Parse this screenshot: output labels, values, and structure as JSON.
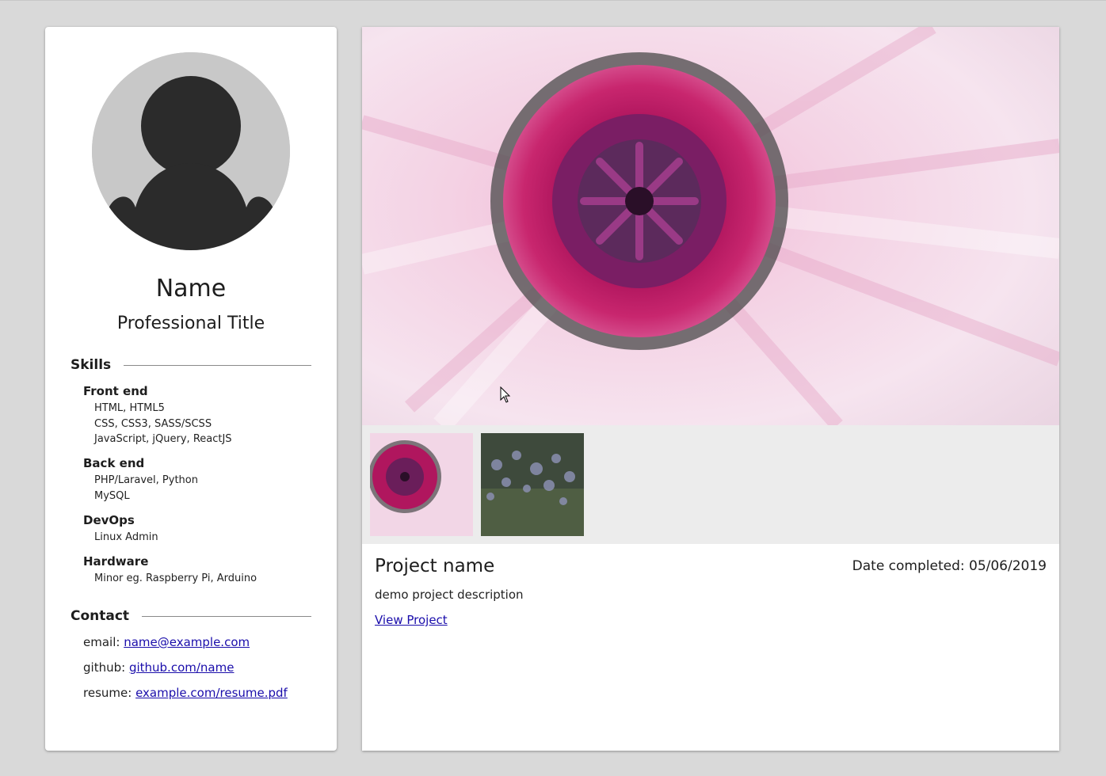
{
  "profile": {
    "name": "Name",
    "title": "Professional Title",
    "avatar_icon": "user-silhouette-icon"
  },
  "skills": {
    "heading": "Skills",
    "groups": [
      {
        "title": "Front end",
        "items": [
          "HTML, HTML5",
          "CSS, CSS3, SASS/SCSS",
          "JavaScript, jQuery, ReactJS"
        ]
      },
      {
        "title": "Back end",
        "items": [
          "PHP/Laravel, Python",
          "MySQL"
        ]
      },
      {
        "title": "DevOps",
        "items": [
          "Linux Admin"
        ]
      },
      {
        "title": "Hardware",
        "items": [
          "Minor eg. Raspberry Pi, Arduino"
        ]
      }
    ]
  },
  "contact": {
    "heading": "Contact",
    "email_label": "email:",
    "email_value": "name@example.com",
    "github_label": "github:",
    "github_value": "github.com/name",
    "resume_label": "resume:",
    "resume_value": "example.com/resume.pdf"
  },
  "project": {
    "name": "Project name",
    "date": "Date completed: 05/06/2019",
    "description": "demo project description",
    "link_label": "View Project"
  },
  "colors": {
    "page_bg": "#d9d9d9",
    "card_bg": "#ffffff",
    "thumb_strip_bg": "#ececec",
    "link": "#1a0dab",
    "flower_center": "#a0145a",
    "petal": "#f2d6e6"
  }
}
